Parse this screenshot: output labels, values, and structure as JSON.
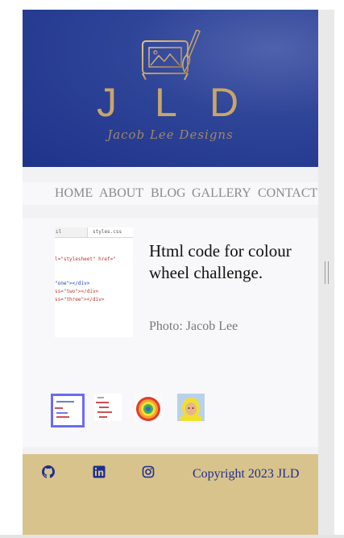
{
  "brand": {
    "letters": [
      "J",
      "L",
      "D"
    ],
    "tagline": "Jacob Lee Designs",
    "gold": "#c9a56b",
    "blue": "#2f4598"
  },
  "nav": {
    "items": [
      "HOME",
      "ABOUT",
      "BLOG",
      "GALLERY",
      "CONTACT"
    ]
  },
  "featured": {
    "tab_left": "ıl",
    "tab_right": "styles.css",
    "code_lines": [
      "l=\"stylesheet\" href=\"",
      "\"one\"></div>",
      "ss=\"two\"></div>",
      "ss=\"three\"></div>"
    ],
    "title": "Html code for colour wheel challenge.",
    "credit": "Photo: Jacob Lee"
  },
  "gallery": {
    "thumbs": [
      "html-code-thumb",
      "css-code-thumb",
      "colour-wheel-thumb",
      "portrait-thumb"
    ],
    "selected_index": 0
  },
  "footer": {
    "icons": [
      "github-icon",
      "linkedin-icon",
      "instagram-icon"
    ],
    "copyright": "Copyright 2023 JLD",
    "bg": "#d9c38c"
  }
}
